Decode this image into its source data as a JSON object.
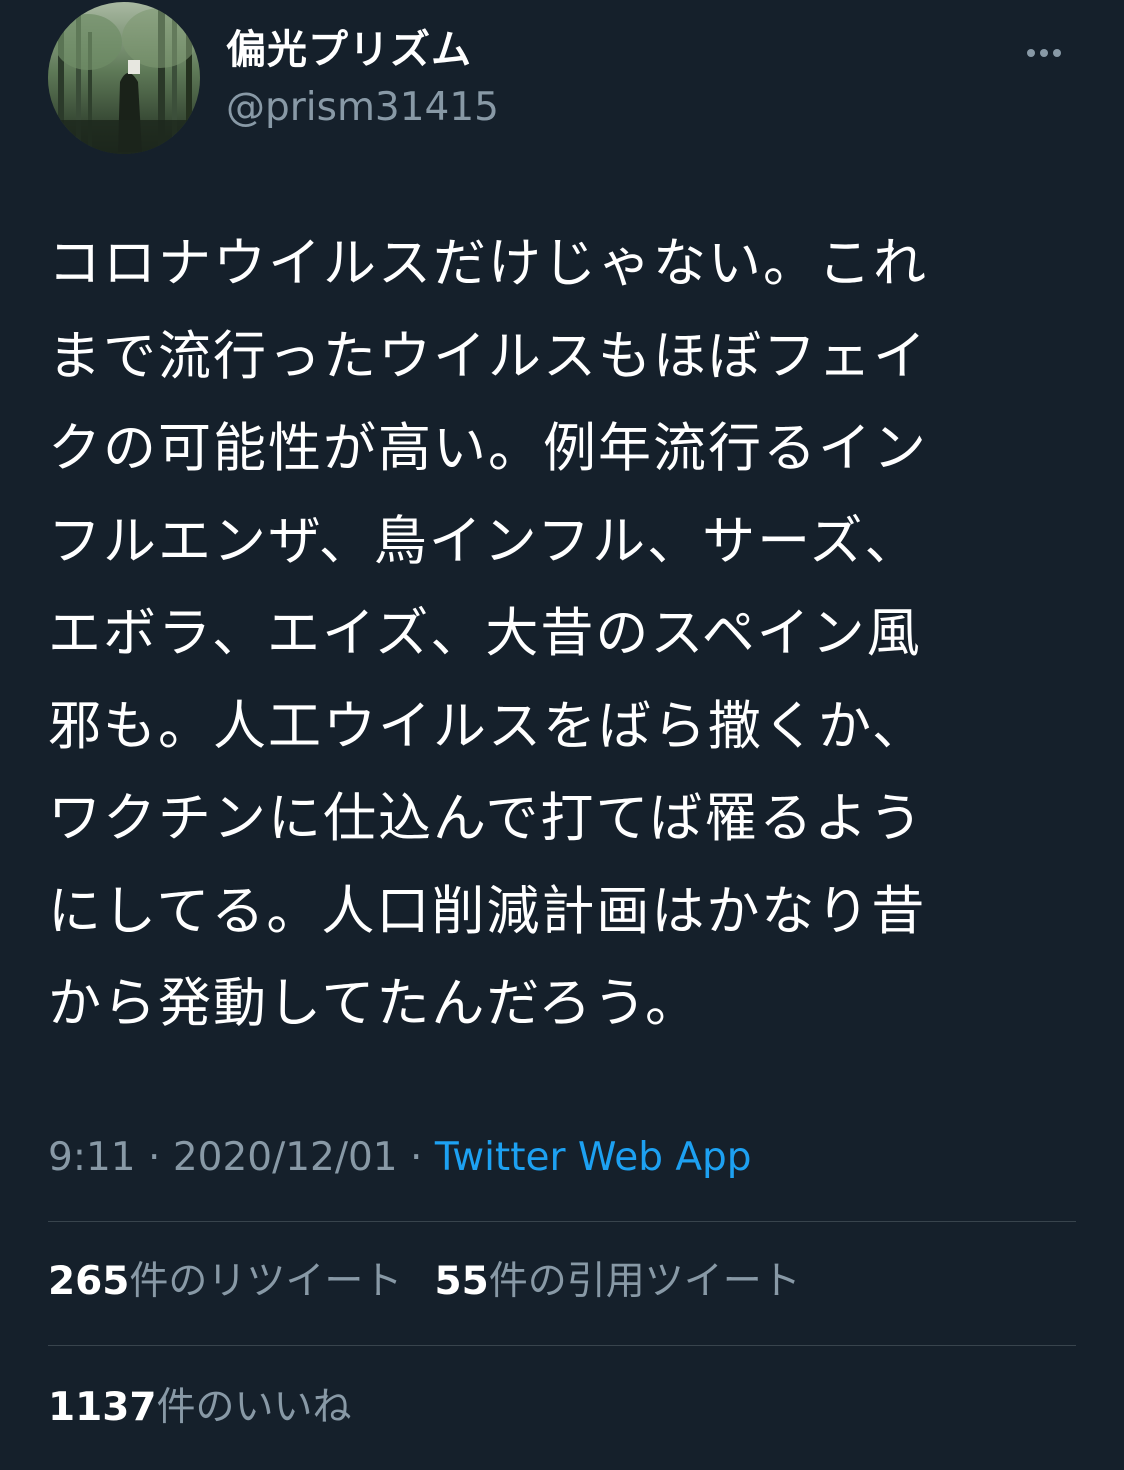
{
  "user": {
    "display_name": "偏光プリズム",
    "handle": "@prism31415"
  },
  "tweet": {
    "lines": [
      "コロナウイルスだけじゃない。これ",
      "まで流行ったウイルスもほぼフェイ",
      "クの可能性が高い。例年流行るイン",
      "フルエンザ、鳥インフル、サーズ、",
      "エボラ、エイズ、大昔のスペイン風",
      "邪も。人工ウイルスをばら撒くか、",
      "ワクチンに仕込んで打てば罹るよう",
      "にしてる。人口削減計画はかなり昔",
      "から発動してたんだろう。"
    ],
    "time": "9:11",
    "separator": "·",
    "date": "2020/12/01",
    "source": "Twitter Web App"
  },
  "stats": {
    "retweets_count": "265",
    "retweets_label": "件のリツイート",
    "quotes_count": "55",
    "quotes_label": "件の引用ツイート",
    "likes_count": "1137",
    "likes_label": "件のいいね"
  },
  "icons": {
    "more": "more-options-icon",
    "avatar": "profile-avatar"
  },
  "colors": {
    "background": "#15202b",
    "secondary_text": "#8899a6",
    "link": "#1da1f2",
    "divider": "#38444d"
  }
}
